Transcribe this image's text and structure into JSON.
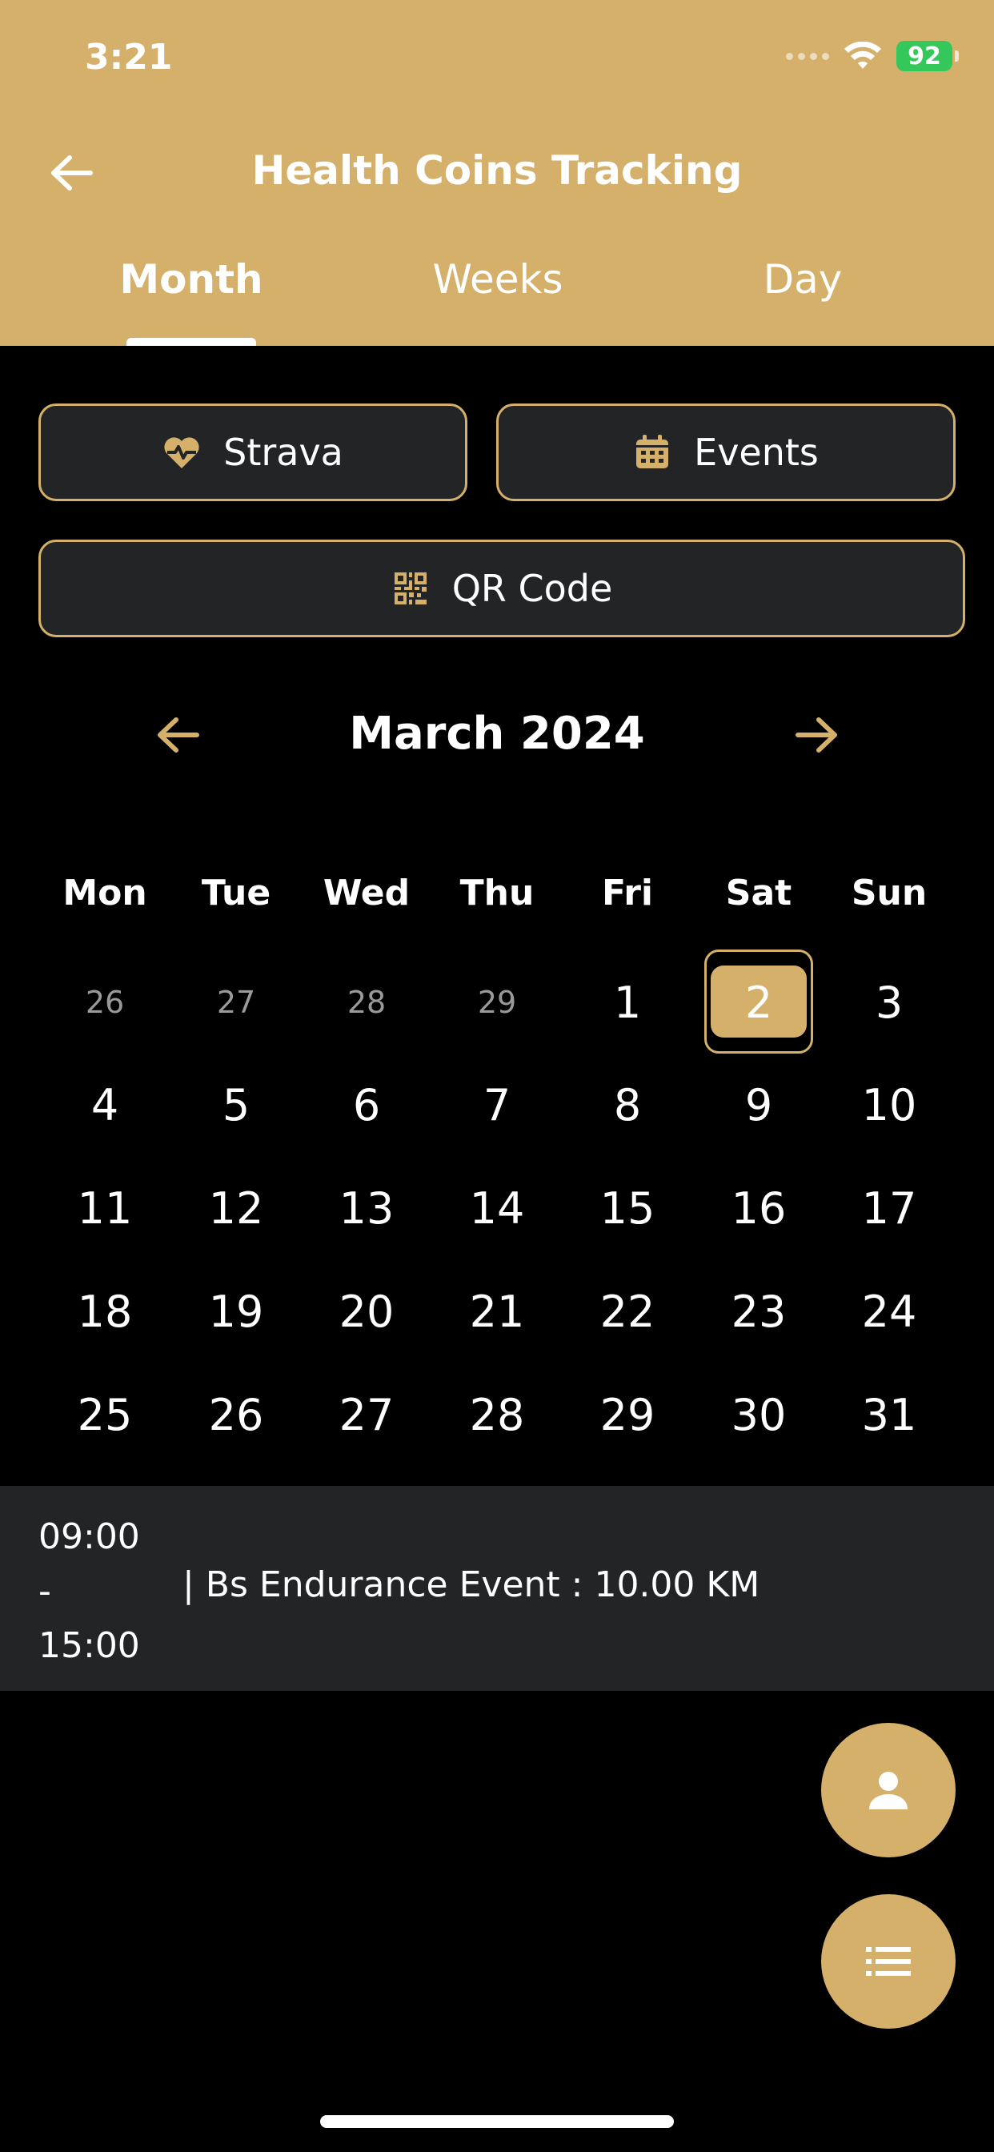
{
  "status_bar": {
    "time": "3:21",
    "battery": "92"
  },
  "header": {
    "title": "Health Coins Tracking"
  },
  "tabs": [
    {
      "label": "Month",
      "active": true
    },
    {
      "label": "Weeks",
      "active": false
    },
    {
      "label": "Day",
      "active": false
    }
  ],
  "actions": {
    "strava_label": "Strava",
    "events_label": "Events",
    "qr_label": "QR Code"
  },
  "calendar": {
    "month_label": "March 2024",
    "weekdays": [
      "Mon",
      "Tue",
      "Wed",
      "Thu",
      "Fri",
      "Sat",
      "Sun"
    ],
    "rows": [
      [
        "26",
        "27",
        "28",
        "29",
        "1",
        "2",
        "3"
      ],
      [
        "4",
        "5",
        "6",
        "7",
        "8",
        "9",
        "10"
      ],
      [
        "11",
        "12",
        "13",
        "14",
        "15",
        "16",
        "17"
      ],
      [
        "18",
        "19",
        "20",
        "21",
        "22",
        "23",
        "24"
      ],
      [
        "25",
        "26",
        "27",
        "28",
        "29",
        "30",
        "31"
      ]
    ],
    "selected_day": "2"
  },
  "event": {
    "time_start": "09:00",
    "time_sep": "-",
    "time_end": "15:00",
    "description": "| Bs Endurance Event : 10.00 KM"
  },
  "colors": {
    "accent": "#d4b06a",
    "surface": "#222426",
    "background": "#000000"
  }
}
